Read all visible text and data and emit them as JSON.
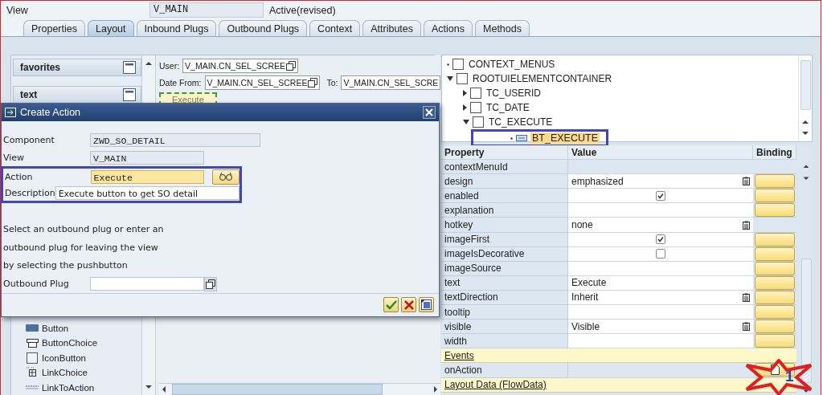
{
  "header": {
    "view_label": "View",
    "view_value": "V_MAIN",
    "status": "Active(revised)"
  },
  "tabs": [
    {
      "label": "Properties",
      "selected": false
    },
    {
      "label": "Layout",
      "selected": true
    },
    {
      "label": "Inbound Plugs",
      "selected": false
    },
    {
      "label": "Outbound Plugs",
      "selected": false
    },
    {
      "label": "Context",
      "selected": false
    },
    {
      "label": "Attributes",
      "selected": false
    },
    {
      "label": "Actions",
      "selected": false
    },
    {
      "label": "Methods",
      "selected": false
    }
  ],
  "palette": {
    "groups": [
      {
        "label": "favorites"
      },
      {
        "label": "text"
      }
    ],
    "items": [
      {
        "label": "Button",
        "kind": "button"
      },
      {
        "label": "ButtonChoice",
        "kind": "choice"
      },
      {
        "label": "IconButton",
        "kind": "icon"
      },
      {
        "label": "LinkChoice",
        "kind": "linkchoice"
      },
      {
        "label": "LinkToAction",
        "kind": "link"
      }
    ]
  },
  "canvas": {
    "user_label": "User:",
    "user_value": "V_MAIN.CN_SEL_SCREE",
    "date_from_label": "Date From:",
    "date_from_value": "V_MAIN.CN_SEL_SCREE",
    "to_label": "To:",
    "to_value": "V_MAIN.CN_SEL_SCRE",
    "button": "Execute"
  },
  "tree": [
    {
      "label": "CONTEXT_MENUS",
      "kind": "container",
      "selected": false,
      "highlighted": false
    },
    {
      "label": "ROOTUIELEMENTCONTAINER",
      "kind": "container",
      "selected": false,
      "highlighted": false,
      "expanded": true,
      "children": [
        {
          "label": "TC_USERID",
          "kind": "container",
          "selected": false,
          "highlighted": false,
          "expanded": false
        },
        {
          "label": "TC_DATE",
          "kind": "container",
          "selected": false,
          "highlighted": false,
          "expanded": false
        },
        {
          "label": "TC_EXECUTE",
          "kind": "container",
          "selected": false,
          "highlighted": false,
          "expanded": true,
          "children": [
            {
              "label": "BT_EXECUTE",
              "kind": "button",
              "selected": true,
              "highlighted": true
            }
          ]
        }
      ]
    }
  ],
  "properties": {
    "columns": [
      "Property",
      "Value",
      "Binding"
    ],
    "rows": [
      {
        "name": "contextMenuId",
        "kind": "text",
        "editable": false,
        "bindable": false
      },
      {
        "name": "design",
        "kind": "dropdown",
        "value": "emphasized",
        "editable": true,
        "bindable": true
      },
      {
        "name": "enabled",
        "kind": "check",
        "checked": true,
        "editable": true,
        "bindable": true
      },
      {
        "name": "explanation",
        "kind": "text",
        "editable": true,
        "bindable": true
      },
      {
        "name": "hotkey",
        "kind": "dropdown",
        "value": "none",
        "editable": true,
        "bindable": false
      },
      {
        "name": "imageFirst",
        "kind": "check",
        "checked": true,
        "editable": true,
        "bindable": true
      },
      {
        "name": "imageIsDecorative",
        "kind": "check",
        "checked": false,
        "editable": true,
        "bindable": true
      },
      {
        "name": "imageSource",
        "kind": "text",
        "editable": true,
        "bindable": true
      },
      {
        "name": "text",
        "kind": "text",
        "value": "Execute",
        "editable": true,
        "bindable": true
      },
      {
        "name": "textDirection",
        "kind": "dropdown",
        "value": "Inherit",
        "editable": true,
        "bindable": true
      },
      {
        "name": "tooltip",
        "kind": "text",
        "editable": true,
        "bindable": true
      },
      {
        "name": "visible",
        "kind": "dropdown",
        "value": "Visible",
        "editable": true,
        "bindable": true
      },
      {
        "name": "width",
        "kind": "text",
        "editable": true,
        "bindable": true
      },
      {
        "name": "Events",
        "kind": "section"
      },
      {
        "name": "onAction",
        "kind": "event",
        "editable": false,
        "bindable": true
      },
      {
        "name": "Layout Data (FlowData)",
        "kind": "section"
      }
    ]
  },
  "dialog": {
    "title": "Create Action",
    "fields": [
      {
        "label": "Component",
        "value": "ZWD_SO_DETAIL",
        "kind": "readonly",
        "highlighted": false
      },
      {
        "label": "View",
        "value": "V_MAIN",
        "kind": "readonly",
        "highlighted": false
      },
      {
        "label": "Action",
        "value": "Execute",
        "kind": "required",
        "highlighted": true
      },
      {
        "label": "Description",
        "value": "Execute button to get SO detail",
        "kind": "input",
        "highlighted": true
      }
    ],
    "hint_lines": [
      "Select an outbound plug or enter an",
      "outbound plug for leaving the view",
      "by selecting the pushbutton"
    ],
    "outbound_plug": {
      "label": "Outbound Plug"
    }
  },
  "annotation": {
    "step": "1"
  }
}
